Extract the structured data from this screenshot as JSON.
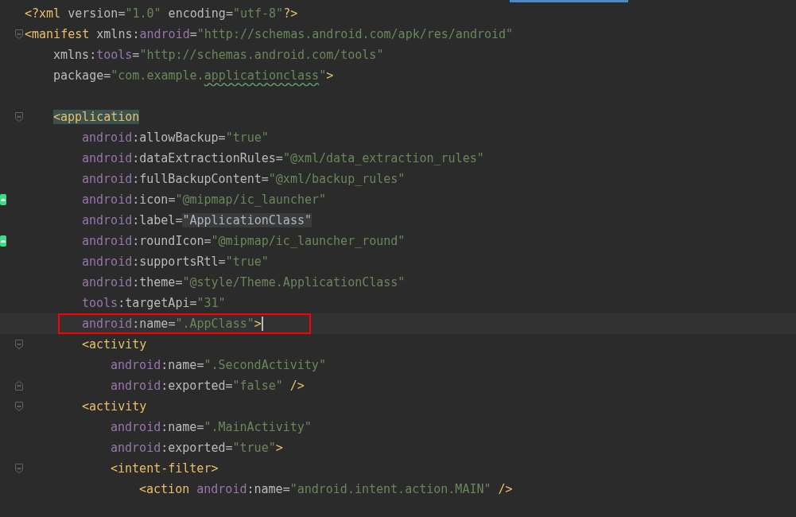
{
  "editor": {
    "lines": [
      {
        "tokens": [
          {
            "kind": "tag",
            "text": "<?xml "
          },
          {
            "kind": "attr",
            "text": "version"
          },
          {
            "kind": "punct",
            "text": "="
          },
          {
            "kind": "str",
            "text": "\"1.0\""
          },
          {
            "kind": "attr",
            "text": " encoding"
          },
          {
            "kind": "punct",
            "text": "="
          },
          {
            "kind": "str",
            "text": "\"utf-8\""
          },
          {
            "kind": "tag",
            "text": "?>"
          }
        ]
      },
      {
        "fold_start": true,
        "tokens": [
          {
            "kind": "tag",
            "text": "<manifest "
          },
          {
            "kind": "attr",
            "text": "xmlns:"
          },
          {
            "kind": "ns",
            "text": "android"
          },
          {
            "kind": "punct",
            "text": "="
          },
          {
            "kind": "str",
            "text": "\"http://schemas.android.com/apk/res/android\""
          }
        ],
        "children": [
          {
            "tokens": [
              {
                "kind": "attr",
                "text": "xmlns:"
              },
              {
                "kind": "ns",
                "text": "tools"
              },
              {
                "kind": "punct",
                "text": "="
              },
              {
                "kind": "str",
                "text": "\"http://schemas.android.com/tools\""
              }
            ]
          },
          {
            "tokens": [
              {
                "kind": "attr",
                "text": "package"
              },
              {
                "kind": "punct",
                "text": "="
              },
              {
                "kind": "str",
                "text": "\"com.example."
              },
              {
                "kind": "str",
                "text": "applicationclass",
                "typo": true
              },
              {
                "kind": "str",
                "text": "\""
              },
              {
                "kind": "tag",
                "text": ">"
              }
            ]
          },
          {
            "blank_line_before": true,
            "fold_start": true,
            "tokens": [
              {
                "kind": "tag",
                "text": "<application",
                "matched": true
              }
            ],
            "children": [
              {
                "tokens": [
                  {
                    "kind": "ns",
                    "text": "android"
                  },
                  {
                    "kind": "attr",
                    "text": ":allowBackup"
                  },
                  {
                    "kind": "punct",
                    "text": "="
                  },
                  {
                    "kind": "str",
                    "text": "\"true\""
                  }
                ]
              },
              {
                "tokens": [
                  {
                    "kind": "ns",
                    "text": "android"
                  },
                  {
                    "kind": "attr",
                    "text": ":dataExtractionRules"
                  },
                  {
                    "kind": "punct",
                    "text": "="
                  },
                  {
                    "kind": "str",
                    "text": "\"@xml/data_extraction_rules\""
                  }
                ]
              },
              {
                "tokens": [
                  {
                    "kind": "ns",
                    "text": "android"
                  },
                  {
                    "kind": "attr",
                    "text": ":fullBackupContent"
                  },
                  {
                    "kind": "punct",
                    "text": "="
                  },
                  {
                    "kind": "str",
                    "text": "\"@xml/backup_rules\""
                  }
                ]
              },
              {
                "gutter_icon": true,
                "tokens": [
                  {
                    "kind": "ns",
                    "text": "android"
                  },
                  {
                    "kind": "attr",
                    "text": ":icon"
                  },
                  {
                    "kind": "punct",
                    "text": "="
                  },
                  {
                    "kind": "str",
                    "text": "\"@mipmap/ic_launcher\""
                  }
                ]
              },
              {
                "tokens": [
                  {
                    "kind": "ns",
                    "text": "android"
                  },
                  {
                    "kind": "attr",
                    "text": ":label"
                  },
                  {
                    "kind": "punct",
                    "text": "="
                  },
                  {
                    "kind": "plain",
                    "text": "\"ApplicationClass\"",
                    "matched": true
                  }
                ]
              },
              {
                "gutter_icon": true,
                "tokens": [
                  {
                    "kind": "ns",
                    "text": "android"
                  },
                  {
                    "kind": "attr",
                    "text": ":roundIcon"
                  },
                  {
                    "kind": "punct",
                    "text": "="
                  },
                  {
                    "kind": "str",
                    "text": "\"@mipmap/ic_launcher_round\""
                  }
                ]
              },
              {
                "tokens": [
                  {
                    "kind": "ns",
                    "text": "android"
                  },
                  {
                    "kind": "attr",
                    "text": ":supportsRtl"
                  },
                  {
                    "kind": "punct",
                    "text": "="
                  },
                  {
                    "kind": "str",
                    "text": "\"true\""
                  }
                ]
              },
              {
                "tokens": [
                  {
                    "kind": "ns",
                    "text": "android"
                  },
                  {
                    "kind": "attr",
                    "text": ":theme"
                  },
                  {
                    "kind": "punct",
                    "text": "="
                  },
                  {
                    "kind": "str",
                    "text": "\"@style/Theme.ApplicationClass\""
                  }
                ]
              },
              {
                "tokens": [
                  {
                    "kind": "ns",
                    "text": "tools"
                  },
                  {
                    "kind": "attr",
                    "text": ":targetApi"
                  },
                  {
                    "kind": "punct",
                    "text": "="
                  },
                  {
                    "kind": "str",
                    "text": "\"31\""
                  }
                ]
              },
              {
                "current": true,
                "boxed": true,
                "caret": true,
                "tokens": [
                  {
                    "kind": "ns",
                    "text": "android"
                  },
                  {
                    "kind": "attr",
                    "text": ":name"
                  },
                  {
                    "kind": "punct",
                    "text": "="
                  },
                  {
                    "kind": "str",
                    "text": "\".AppClass\""
                  },
                  {
                    "kind": "tag",
                    "text": ">"
                  }
                ]
              },
              {
                "fold_start": true,
                "tokens": [
                  {
                    "kind": "tag",
                    "text": "<activity"
                  }
                ],
                "children": [
                  {
                    "tokens": [
                      {
                        "kind": "ns",
                        "text": "android"
                      },
                      {
                        "kind": "attr",
                        "text": ":name"
                      },
                      {
                        "kind": "punct",
                        "text": "="
                      },
                      {
                        "kind": "str",
                        "text": "\".SecondActivity\""
                      }
                    ]
                  },
                  {
                    "fold_end": true,
                    "tokens": [
                      {
                        "kind": "ns",
                        "text": "android"
                      },
                      {
                        "kind": "attr",
                        "text": ":exported"
                      },
                      {
                        "kind": "punct",
                        "text": "="
                      },
                      {
                        "kind": "str",
                        "text": "\"false\""
                      },
                      {
                        "kind": "tag",
                        "text": " />"
                      }
                    ]
                  }
                ]
              },
              {
                "fold_start": true,
                "tokens": [
                  {
                    "kind": "tag",
                    "text": "<activity"
                  }
                ],
                "children": [
                  {
                    "tokens": [
                      {
                        "kind": "ns",
                        "text": "android"
                      },
                      {
                        "kind": "attr",
                        "text": ":name"
                      },
                      {
                        "kind": "punct",
                        "text": "="
                      },
                      {
                        "kind": "str",
                        "text": "\".MainActivity\""
                      }
                    ]
                  },
                  {
                    "tokens": [
                      {
                        "kind": "ns",
                        "text": "android"
                      },
                      {
                        "kind": "attr",
                        "text": ":exported"
                      },
                      {
                        "kind": "punct",
                        "text": "="
                      },
                      {
                        "kind": "str",
                        "text": "\"true\""
                      },
                      {
                        "kind": "tag",
                        "text": ">"
                      }
                    ]
                  },
                  {
                    "fold_start": true,
                    "tokens": [
                      {
                        "kind": "tag",
                        "text": "<intent-filter>"
                      }
                    ],
                    "children": [
                      {
                        "tokens": [
                          {
                            "kind": "tag",
                            "text": "<action "
                          },
                          {
                            "kind": "ns",
                            "text": "android"
                          },
                          {
                            "kind": "attr",
                            "text": ":name"
                          },
                          {
                            "kind": "punct",
                            "text": "="
                          },
                          {
                            "kind": "str",
                            "text": "\"android.intent.action.MAIN\""
                          },
                          {
                            "kind": "tag",
                            "text": " />"
                          }
                        ]
                      }
                    ]
                  }
                ]
              }
            ]
          }
        ]
      }
    ]
  }
}
